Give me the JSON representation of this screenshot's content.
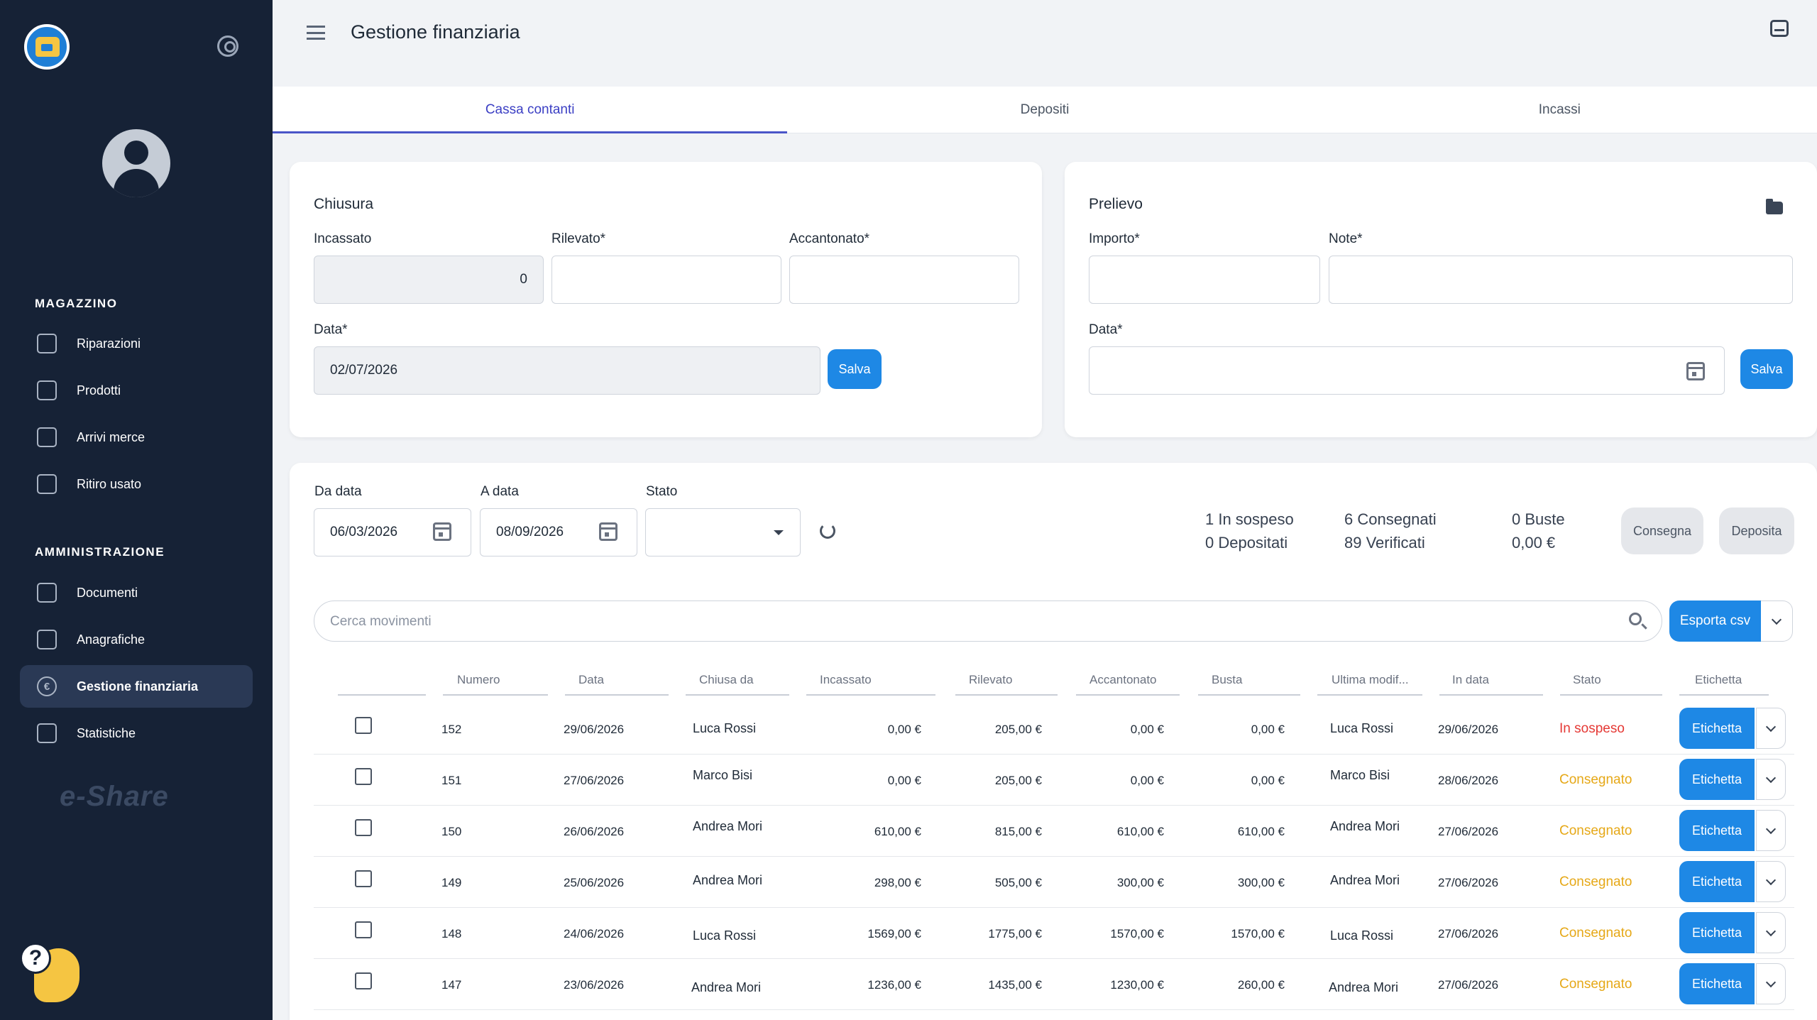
{
  "sidebar": {
    "sections": [
      {
        "title": "MAGAZZINO",
        "items": [
          {
            "label": "Riparazioni",
            "icon": "toolbox-icon"
          },
          {
            "label": "Prodotti",
            "icon": "box-icon"
          },
          {
            "label": "Arrivi merce",
            "icon": "truck-icon"
          },
          {
            "label": "Ritiro usato",
            "icon": "clipboard-icon"
          }
        ]
      },
      {
        "title": "AMMINISTRAZIONE",
        "items": [
          {
            "label": "Documenti",
            "icon": "document-icon"
          },
          {
            "label": "Anagrafiche",
            "icon": "id-card-icon"
          },
          {
            "label": "Gestione finanziaria",
            "icon": "euro-icon",
            "active": true
          },
          {
            "label": "Statistiche",
            "icon": "bar-chart-icon"
          }
        ]
      }
    ],
    "brand_watermark": "e-Share",
    "help_glyph": "?"
  },
  "header": {
    "title": "Gestione finanziaria"
  },
  "tabs": [
    {
      "label": "Cassa contanti",
      "active": true
    },
    {
      "label": "Depositi",
      "active": false
    },
    {
      "label": "Incassi",
      "active": false
    }
  ],
  "chiusura": {
    "title": "Chiusura",
    "incassato_label": "Incassato",
    "incassato_value": "0",
    "rilevato_label": "Rilevato*",
    "rilevato_value": "",
    "accantonato_label": "Accantonato*",
    "accantonato_value": "",
    "data_label": "Data*",
    "data_value": "02/07/2026",
    "save_label": "Salva"
  },
  "prelievo": {
    "title": "Prelievo",
    "importo_label": "Importo*",
    "importo_value": "",
    "note_label": "Note*",
    "note_value": "",
    "data_label": "Data*",
    "data_value": "",
    "save_label": "Salva"
  },
  "filters": {
    "da_data_label": "Da data",
    "da_data_value": "06/03/2026",
    "a_data_label": "A data",
    "a_data_value": "08/09/2026",
    "stato_label": "Stato",
    "stato_value": ""
  },
  "stats": {
    "in_sospeso": "1  In sospeso",
    "depositati": "0  Depositati",
    "consegnati": "6  Consegnati",
    "verificati": "89  Verificati",
    "buste": "0  Buste",
    "totale": "0,00 €"
  },
  "actions": {
    "consegna_label": "Consegna",
    "deposita_label": "Deposita"
  },
  "search": {
    "placeholder": "Cerca movimenti",
    "export_label": "Esporta csv"
  },
  "table": {
    "columns": [
      "Numero",
      "Data",
      "Chiusa da",
      "Incassato",
      "Rilevato",
      "Accantonato",
      "Busta",
      "Ultima modif...",
      "In data",
      "Stato",
      "Etichetta"
    ],
    "rows": [
      {
        "numero": "152",
        "data": "29/06/2026",
        "chiusa_da": "Luca Rossi",
        "incassato": "0,00 €",
        "rilevato": "205,00 €",
        "accantonato": "0,00 €",
        "busta": "0,00 €",
        "ultima_modifica": "Luca Rossi",
        "in_data": "29/06/2026",
        "stato": "In sospeso",
        "etichetta": "Etichetta"
      },
      {
        "numero": "151",
        "data": "27/06/2026",
        "chiusa_da": "Marco Bisi",
        "incassato": "0,00 €",
        "rilevato": "205,00 €",
        "accantonato": "0,00 €",
        "busta": "0,00 €",
        "ultima_modifica": "Marco Bisi",
        "in_data": "28/06/2026",
        "stato": "Consegnato",
        "etichetta": "Etichetta"
      },
      {
        "numero": "150",
        "data": "26/06/2026",
        "chiusa_da": "Andrea Mori",
        "incassato": "610,00 €",
        "rilevato": "815,00 €",
        "accantonato": "610,00 €",
        "busta": "610,00 €",
        "ultima_modifica": "Andrea Mori",
        "in_data": "27/06/2026",
        "stato": "Consegnato",
        "etichetta": "Etichetta"
      },
      {
        "numero": "149",
        "data": "25/06/2026",
        "chiusa_da": "Andrea Mori",
        "incassato": "298,00 €",
        "rilevato": "505,00 €",
        "accantonato": "300,00 €",
        "busta": "300,00 €",
        "ultima_modifica": "Andrea Mori",
        "in_data": "27/06/2026",
        "stato": "Consegnato",
        "etichetta": "Etichetta"
      },
      {
        "numero": "148",
        "data": "24/06/2026",
        "chiusa_da": "Luca Rossi",
        "incassato": "1569,00 €",
        "rilevato": "1775,00 €",
        "accantonato": "1570,00 €",
        "busta": "1570,00 €",
        "ultima_modifica": "Luca Rossi",
        "in_data": "27/06/2026",
        "stato": "Consegnato",
        "etichetta": "Etichetta"
      },
      {
        "numero": "147",
        "data": "23/06/2026",
        "chiusa_da": "Andrea Mori",
        "incassato": "1236,00 €",
        "rilevato": "1435,00 €",
        "accantonato": "1230,00 €",
        "busta": "260,00 €",
        "ultima_modifica": "Andrea Mori",
        "in_data": "27/06/2026",
        "stato": "Consegnato",
        "etichetta": "Etichetta"
      }
    ]
  },
  "colors": {
    "sidebar_bg": "#162236",
    "accent": "#1e88e5",
    "tab_active": "#3b3fc4",
    "status_pending": "#e53935",
    "status_delivered": "#e6a817"
  }
}
